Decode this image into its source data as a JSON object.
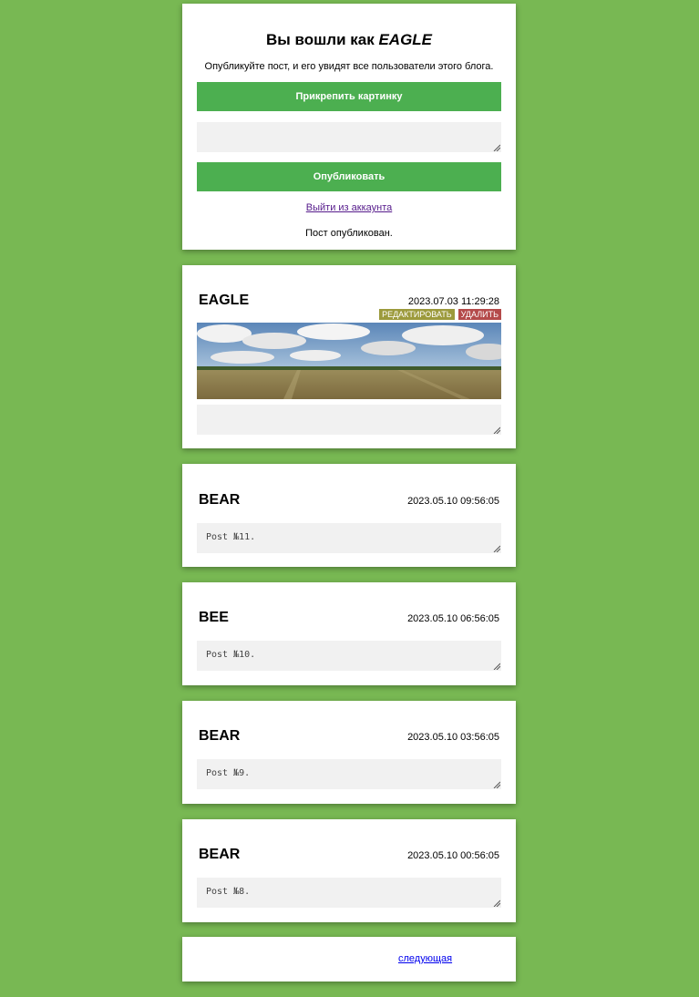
{
  "login": {
    "title_prefix": "Вы вошли как ",
    "username": "EAGLE",
    "description": "Опубликуйте пост, и его увидят все пользователи этого блога.",
    "attach_label": "Прикрепить картинку",
    "textarea_value": "",
    "publish_label": "Опубликовать",
    "logout_label": "Выйти из аккаунта",
    "status": "Пост опубликован."
  },
  "posts": [
    {
      "author": "EAGLE",
      "date": "2023.07.03 11:29:28",
      "edit_label": "РЕДАКТИРОВАТЬ",
      "delete_label": "УДАЛИТЬ",
      "text": ""
    },
    {
      "author": "BEAR",
      "date": "2023.05.10 09:56:05",
      "text": "Post №11."
    },
    {
      "author": "BEE",
      "date": "2023.05.10 06:56:05",
      "text": "Post №10."
    },
    {
      "author": "BEAR",
      "date": "2023.05.10 03:56:05",
      "text": "Post №9."
    },
    {
      "author": "BEAR",
      "date": "2023.05.10 00:56:05",
      "text": "Post №8."
    }
  ],
  "pagination": {
    "next_label": "следующая"
  },
  "colors": {
    "background": "#78b853",
    "button": "#4caf50",
    "edit": "#9c9a3c",
    "delete": "#b44a4a"
  }
}
